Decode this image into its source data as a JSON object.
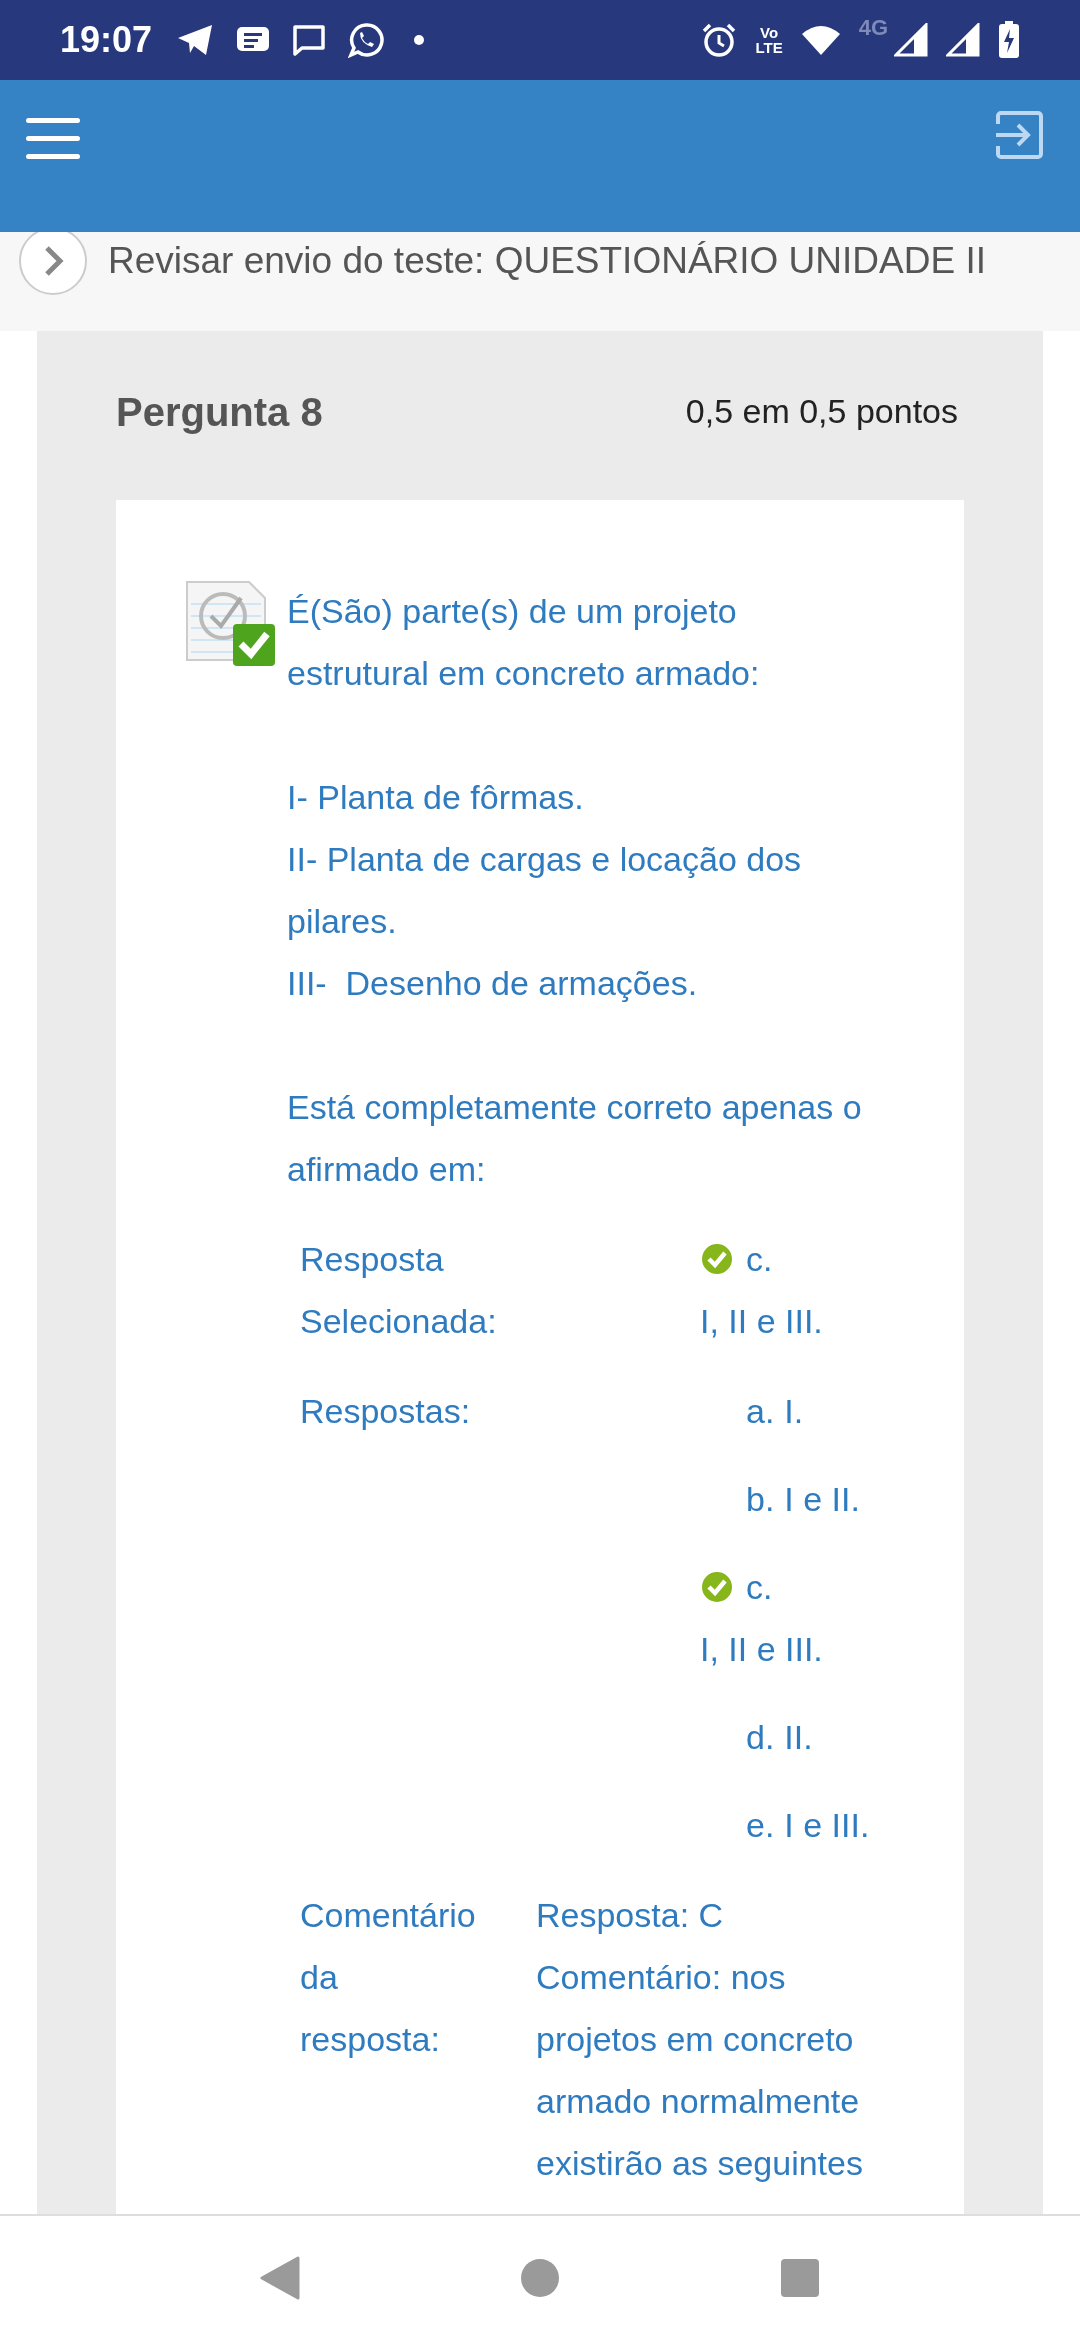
{
  "status_bar": {
    "time": "19:07",
    "volte_top": "Vo",
    "volte_bottom": "LTE",
    "network": "4G"
  },
  "breadcrumb": "Revisar envio do teste: QUESTIONÁRIO UNIDADE II",
  "question": {
    "title": "Pergunta 8",
    "score": "0,5 em 0,5 pontos",
    "correct": true,
    "paragraphs": [
      [
        "É(São) parte(s) de um projeto estrutural em concreto armado:"
      ],
      [
        "I- Planta de fôrmas.",
        "II- Planta de cargas e locação dos pilares.",
        "III-  Desenho de armações."
      ],
      [
        "Está completamente correto apenas o afirmado em:"
      ]
    ]
  },
  "selected_answer": {
    "label": "Resposta Selecionada:",
    "letter": "c.",
    "text": "I, II e III.",
    "correct": true
  },
  "answers_label": "Respostas:",
  "answers": [
    {
      "letter": "a.",
      "text": "I.",
      "correct": false
    },
    {
      "letter": "b.",
      "text": "I e II.",
      "correct": false
    },
    {
      "letter": "c.",
      "text": "I, II e III.",
      "correct": true
    },
    {
      "letter": "d.",
      "text": "II.",
      "correct": false
    },
    {
      "letter": "e.",
      "text": "I e III.",
      "correct": false
    }
  ],
  "comment": {
    "label": "Comentário da resposta:",
    "lines": [
      "Resposta: C",
      "Comentário: nos projetos em concreto armado normalmente existirão as seguintes"
    ]
  }
}
